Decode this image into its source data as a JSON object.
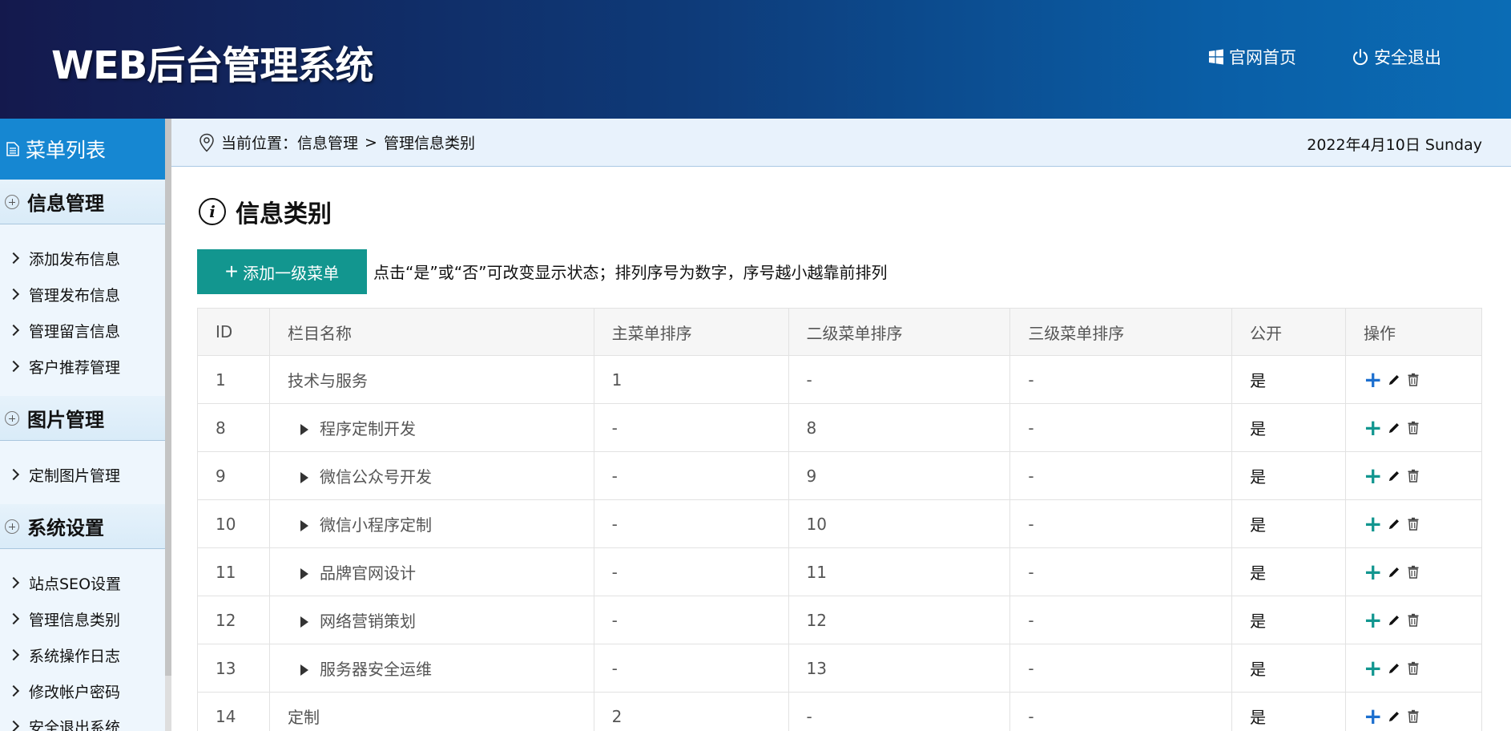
{
  "header": {
    "logo": "WEB后台管理系统",
    "home_label": "官网首页",
    "logout_label": "安全退出"
  },
  "sidebar": {
    "title": "菜单列表",
    "groups": [
      {
        "label": "信息管理",
        "items": [
          "添加发布信息",
          "管理发布信息",
          "管理留言信息",
          "客户推荐管理"
        ]
      },
      {
        "label": "图片管理",
        "items": [
          "定制图片管理"
        ]
      },
      {
        "label": "系统设置",
        "items": [
          "站点SEO设置",
          "管理信息类别",
          "系统操作日志",
          "修改帐户密码",
          "安全退出系统"
        ]
      }
    ]
  },
  "breadcrumb": {
    "prefix": "当前位置：",
    "level1": "信息管理",
    "separator": ">",
    "level2": "管理信息类别",
    "date": "2022年4月10日 Sunday"
  },
  "section": {
    "title": "信息类别",
    "add_button": "添加一级菜单",
    "add_button_plus": "+",
    "hint": "点击“是”或“否”可改变显示状态；排列序号为数字，序号越小越靠前排列"
  },
  "table": {
    "columns": [
      "ID",
      "栏目名称",
      "主菜单排序",
      "二级菜单排序",
      "三级菜单排序",
      "公开",
      "操作"
    ],
    "rows": [
      {
        "id": "1",
        "name": "技术与服务",
        "main": "1",
        "second": "-",
        "third": "-",
        "public": "是",
        "child": false
      },
      {
        "id": "8",
        "name": "程序定制开发",
        "main": "-",
        "second": "8",
        "third": "-",
        "public": "是",
        "child": true
      },
      {
        "id": "9",
        "name": "微信公众号开发",
        "main": "-",
        "second": "9",
        "third": "-",
        "public": "是",
        "child": true
      },
      {
        "id": "10",
        "name": "微信小程序定制",
        "main": "-",
        "second": "10",
        "third": "-",
        "public": "是",
        "child": true
      },
      {
        "id": "11",
        "name": "品牌官网设计",
        "main": "-",
        "second": "11",
        "third": "-",
        "public": "是",
        "child": true
      },
      {
        "id": "12",
        "name": "网络营销策划",
        "main": "-",
        "second": "12",
        "third": "-",
        "public": "是",
        "child": true
      },
      {
        "id": "13",
        "name": "服务器安全运维",
        "main": "-",
        "second": "13",
        "third": "-",
        "public": "是",
        "child": true
      },
      {
        "id": "14",
        "name": "定制",
        "main": "2",
        "second": "-",
        "third": "-",
        "public": "是",
        "child": false
      }
    ],
    "op_add_symbol": "+"
  },
  "colors": {
    "header_start": "#14194d",
    "header_end": "#0b6cb5",
    "sidebar_title_bg": "#1687d2",
    "add_button_bg": "#12968f",
    "op_add_blue": "#1c6fcf",
    "op_add_teal": "#12968f"
  },
  "icons": {
    "home": "windows-icon",
    "logout": "power-icon",
    "sidebar_title": "document-icon",
    "breadcrumb": "location-pin-icon",
    "section": "info-icon",
    "edit": "pencil-icon",
    "delete": "trash-icon"
  }
}
